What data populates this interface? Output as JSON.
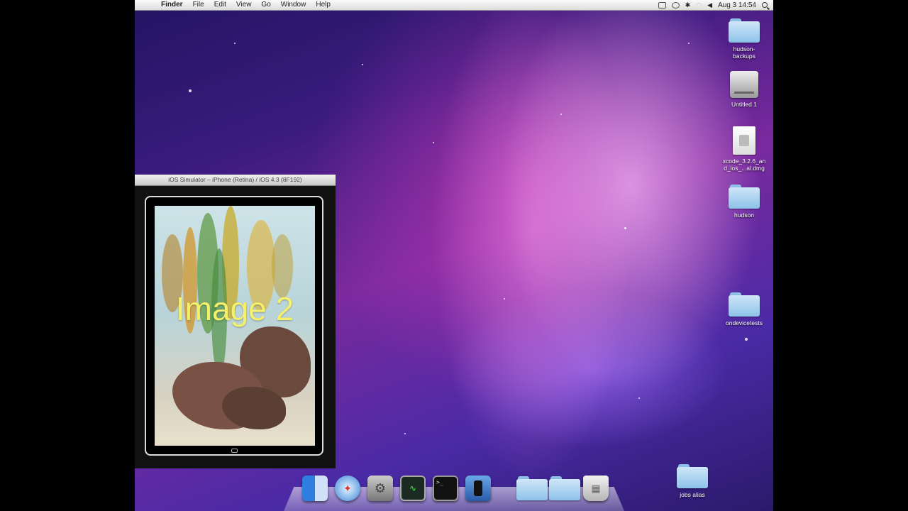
{
  "menubar": {
    "apple": "",
    "app_name": "Finder",
    "menus": [
      "File",
      "Edit",
      "View",
      "Go",
      "Window",
      "Help"
    ],
    "clock": "Aug 3  14:54"
  },
  "desktop_icons": [
    {
      "label": "hudson-\nbackups",
      "kind": "folder-icon"
    },
    {
      "label": "Untitled 1",
      "kind": "drive-icon"
    },
    {
      "label": "xcode_3.2.6_an\nd_ios_...al.dmg",
      "kind": "dmg-icon"
    },
    {
      "label": "hudson",
      "kind": "folder-icon"
    },
    {
      "label": "ondevicetests",
      "kind": "folder-icon"
    },
    {
      "label": "jobs alias",
      "kind": "folder-icon"
    }
  ],
  "simulator": {
    "title": "iOS Simulator – iPhone (Retina) / iOS 4.3 (8F192)",
    "image_caption": "Image 2"
  },
  "dock": [
    "finder-icon",
    "safari-icon",
    "system-preferences-icon",
    "activity-monitor-icon",
    "terminal-icon",
    "iphone-simulator-icon",
    "applications-folder-icon",
    "documents-folder-icon",
    "trash-icon"
  ]
}
